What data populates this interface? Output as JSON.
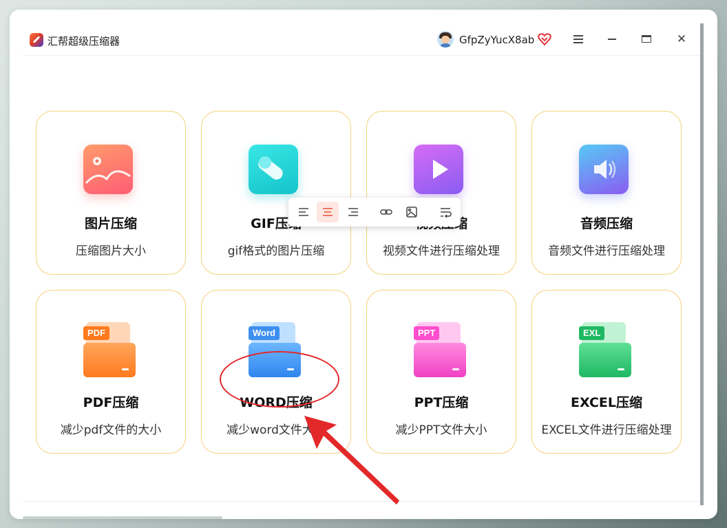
{
  "titlebar": {
    "app_title": "汇帮超级压缩器",
    "username": "GfpZyYucX8ab"
  },
  "cards": [
    {
      "title": "图片压缩",
      "desc": "压缩图片大小",
      "icon": "image-icon"
    },
    {
      "title": "GIF压缩",
      "desc": "gif格式的图片压缩",
      "icon": "gif-icon"
    },
    {
      "title": "视频压缩",
      "desc": "视频文件进行压缩处理",
      "icon": "video-play-icon"
    },
    {
      "title": "音频压缩",
      "desc": "音频文件进行压缩处理",
      "icon": "speaker-icon"
    },
    {
      "title": "PDF压缩",
      "desc": "减少pdf文件的大小",
      "tag": "PDF",
      "icon": "pdf-folder-icon"
    },
    {
      "title": "WORD压缩",
      "desc": "减少word文件大小",
      "tag": "Word",
      "icon": "word-folder-icon"
    },
    {
      "title": "PPT压缩",
      "desc": "减少PPT文件大小",
      "tag": "PPT",
      "icon": "ppt-folder-icon"
    },
    {
      "title": "EXCEL压缩",
      "desc": "EXCEL文件进行压缩处理",
      "tag": "EXL",
      "icon": "excel-folder-icon"
    }
  ],
  "format_toolbar": {
    "buttons": [
      "align-left-icon",
      "align-center-icon",
      "align-right-icon",
      "link-icon",
      "image-insert-icon",
      "text-wrap-icon"
    ],
    "active": "align-center-icon"
  },
  "annotation": {
    "highlight_color": "#e3282a",
    "highlighted_item": "WORD压缩"
  }
}
